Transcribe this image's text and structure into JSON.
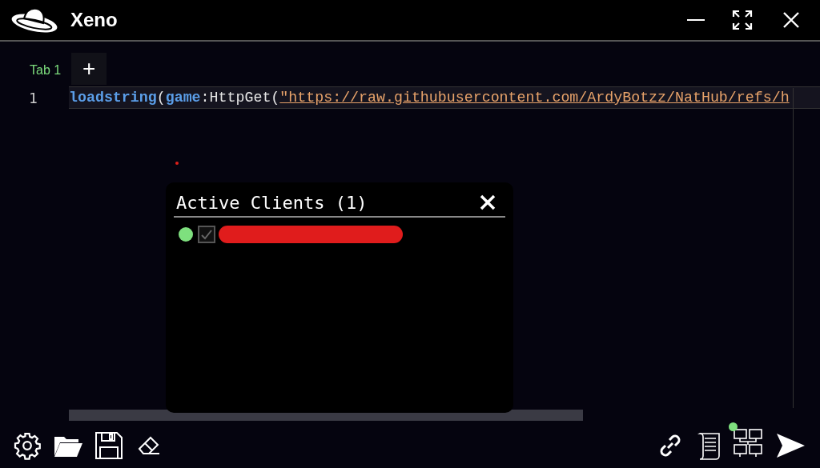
{
  "window": {
    "title": "Xeno"
  },
  "tabs": [
    {
      "label": "Tab 1",
      "selected": true
    }
  ],
  "add_tab": "+",
  "editor": {
    "lines": [
      {
        "number": "1",
        "tokens": [
          {
            "kind": "function",
            "text": "loadstring"
          },
          {
            "kind": "plain",
            "text": "("
          },
          {
            "kind": "global",
            "text": "game"
          },
          {
            "kind": "plain",
            "text": ":HttpGet("
          },
          {
            "kind": "string",
            "text": "\"https://raw.githubusercontent.com/ArdyBotzz/NatHub/refs/h"
          }
        ]
      }
    ]
  },
  "clients_dialog": {
    "title": "Active Clients (1)",
    "clients": [
      {
        "online": true,
        "checked": true,
        "redacted": true
      }
    ]
  },
  "toolbar": {
    "clients_online": true
  }
}
